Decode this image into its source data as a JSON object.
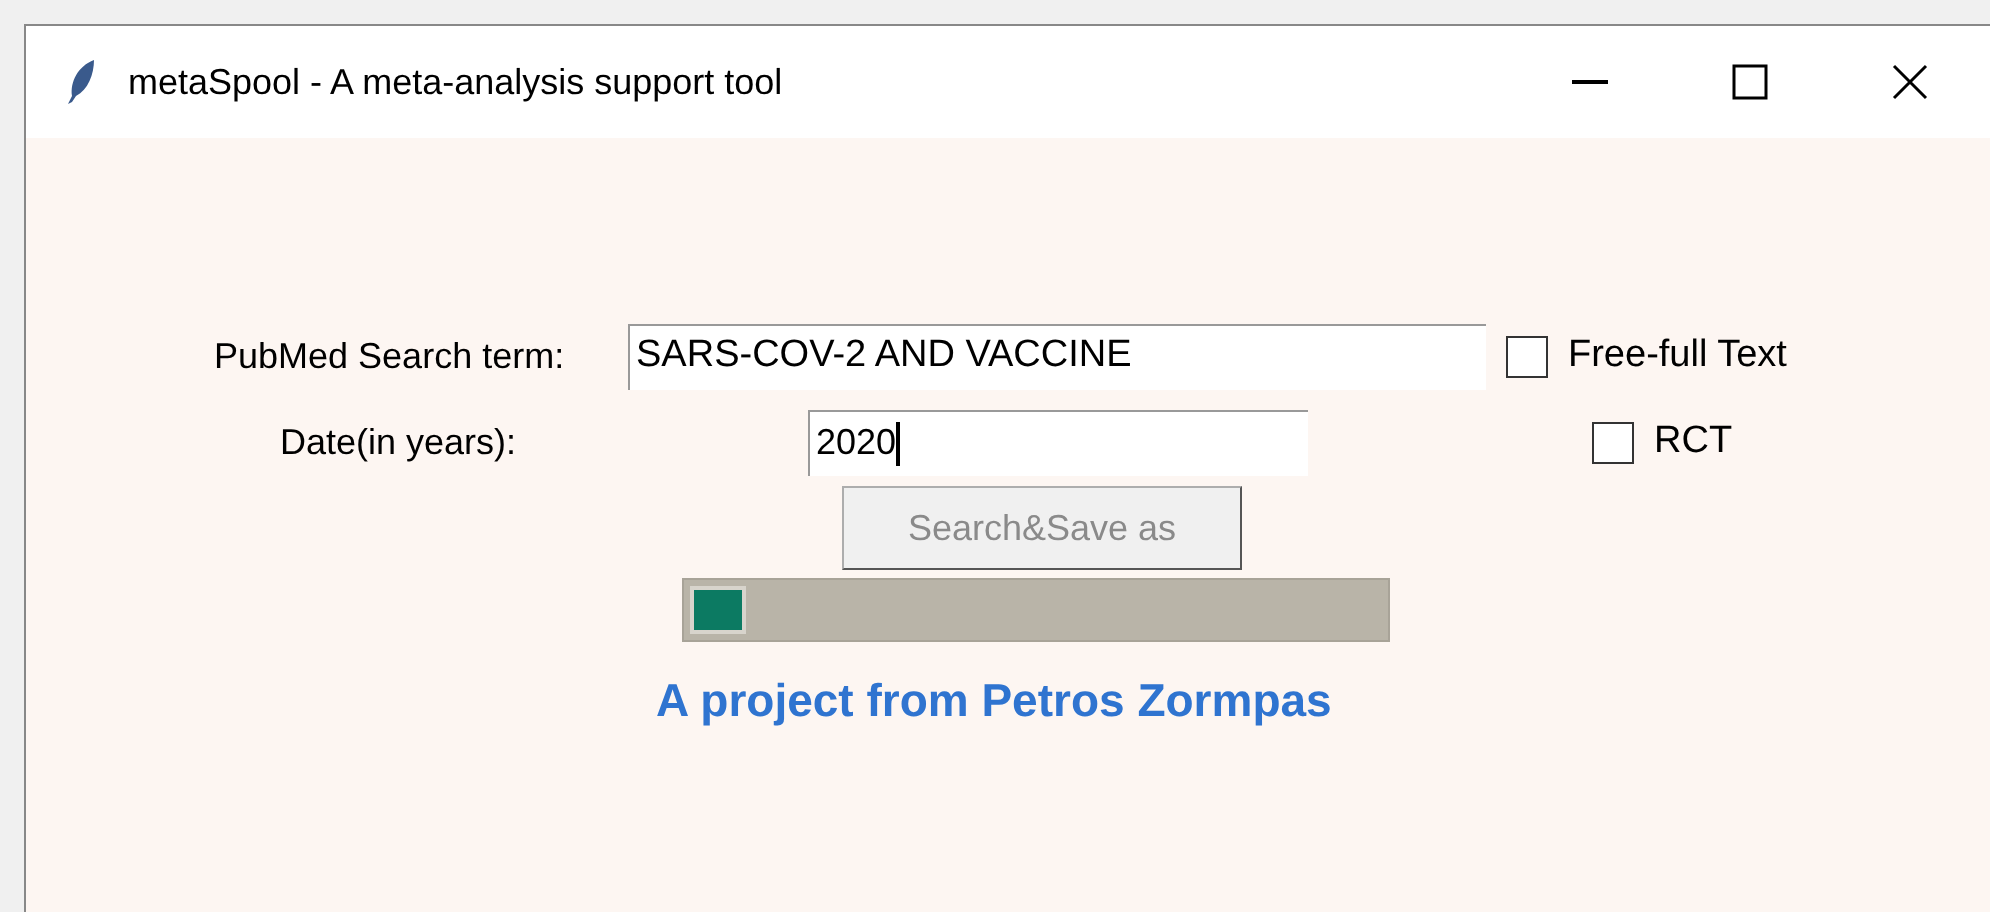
{
  "window": {
    "title": "metaSpool - A meta-analysis support tool"
  },
  "search": {
    "label": "PubMed Search term:",
    "value": "SARS-COV-2 AND VACCINE"
  },
  "free_full_text": {
    "label": "Free-full Text",
    "checked": false
  },
  "date": {
    "label": "Date(in years):",
    "value": "2020"
  },
  "rct": {
    "label": "RCT",
    "checked": false
  },
  "button": {
    "label": "Search&Save as",
    "disabled": true
  },
  "progress": {
    "level": 0.08
  },
  "credit": "A project from Petros Zormpas"
}
